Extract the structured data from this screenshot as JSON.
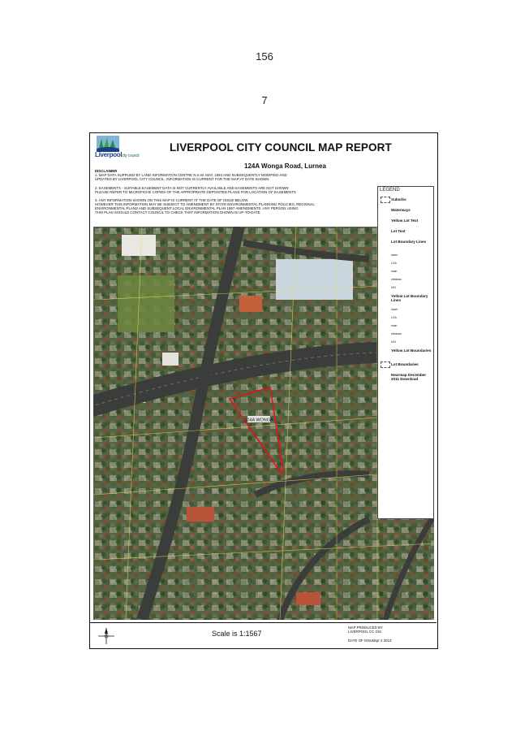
{
  "page": {
    "number_top": "156",
    "number_sub": "7"
  },
  "report": {
    "title": "LIVERPOOL CITY COUNCIL MAP REPORT",
    "address": "124A Wonga Road, Lurnea",
    "logo": {
      "name": "Liverpool",
      "suffix": "city council"
    },
    "disclaimer_heading": "DISCLAIMER",
    "disclaimer": [
      "1. MAP DATA SUPPLIED BY LAND INFORMATION CENTRE N.S.W. MAY, 1994 AND SUBSEQUENTLY MODIFIED AND\nUPDATED BY LIVERPOOL CITY COUNCIL. INFORMATION IS CURRENT FOR THE MAP AT DATE SHOWN.",
      "2. EASEMENTS - SUITABLE EASEMENT DATA IS NOT CURRENTLY AVAILABLE AND EASEMENTS ARE NOT SHOWN\nPLEASE REFER TO MICROFICHE COPIES OF THE APPROPRIATE DEPOSITED PLANS FOR LOCATION OF EASEMENTS",
      "3. ANY INFORMATION SHOWN ON THIS MAP IS CURRENT AT THE DATE OF ISSUE BELOW\nHOWEVER THIS INFORMATION MAY BE SUBJECT TO AMENDMENT BY STATE ENVIRONMENTAL PLANNING POLICIES, REGIONAL\nENVIRONMENTAL PLANS AND SUBSEQUENT LOCAL ENVIRONMENTAL PLAN 1997 AMENDMENTS. ANY PERSON USING\nTHIS PLAN SHOULD CONTACT COUNCIL TO CHECK THAT INFORMATION SHOWN IS UP-TO-DATE"
    ],
    "legend": {
      "title": "LEGEND",
      "items": [
        {
          "label": "Suburbs",
          "size": "normal",
          "swatch": true
        },
        {
          "label": "Waterways",
          "size": "normal"
        },
        {
          "label": "Yellow Lot Text",
          "size": "normal"
        },
        {
          "label": "Lot Text",
          "size": "normal"
        },
        {
          "label": "Lot Boundary Lines",
          "size": "normal"
        },
        {
          "label": "lower",
          "size": "small"
        },
        {
          "label": "LGA",
          "size": "small"
        },
        {
          "label": "main",
          "size": "small"
        },
        {
          "label": "vtrtdown",
          "size": "small"
        },
        {
          "label": "UKL",
          "size": "small"
        },
        {
          "label": "Yellow Lot Boundary Lines",
          "size": "normal"
        },
        {
          "label": "lower",
          "size": "small"
        },
        {
          "label": "LGA",
          "size": "small"
        },
        {
          "label": "main",
          "size": "small"
        },
        {
          "label": "vtrtdown",
          "size": "small"
        },
        {
          "label": "UKL",
          "size": "small"
        },
        {
          "label": "Yellow Lot Boundaries",
          "size": "normal"
        },
        {
          "label": "Lot Boundaries",
          "size": "normal",
          "swatch": true
        },
        {
          "label": "Nearmap December 2011 Download",
          "size": "normal"
        }
      ]
    },
    "map": {
      "lot_label": "124A WONGA"
    },
    "footer": {
      "scale": "Scale is 1:1567",
      "produced_by": "MAP PRODUCED BY\nLIVERPOOL CC GIS",
      "issue_label": "DATE OF ISSUE:",
      "issue_date": "Apr 2 2013"
    }
  },
  "colors": {
    "lot_outline": "#e3121b",
    "lot_lines": "#e6e15a",
    "road": "#3a3d3a",
    "vegetation": "#2f4a22"
  }
}
